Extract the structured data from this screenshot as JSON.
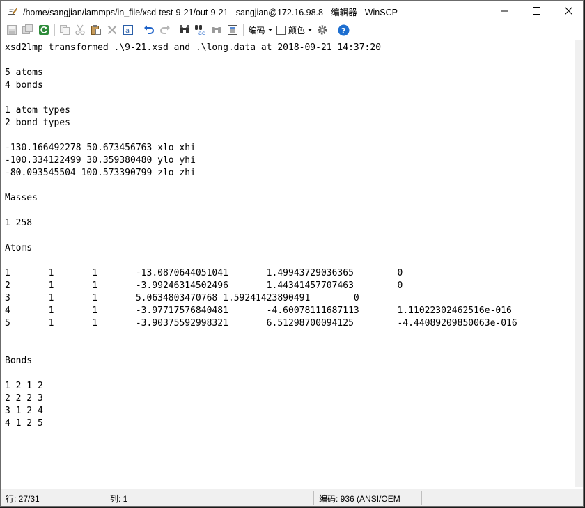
{
  "window": {
    "title": "/home/sangjian/lammps/in_file/xsd-test-9-21/out-9-21 - sangjian@172.16.98.8 - 编辑器 - WinSCP"
  },
  "toolbar": {
    "icons": [
      "save-icon",
      "save-all-icon",
      "reload-icon",
      "copy-icon",
      "cut-icon",
      "paste-icon",
      "delete-icon",
      "select-all-icon",
      "undo-icon",
      "redo-icon",
      "find-icon",
      "replace-icon",
      "find-next-icon",
      "goto-line-icon",
      "settings-icon",
      "help-icon"
    ],
    "encoding_label": "编码",
    "color_label": "颜色",
    "accent": "#1e6fd0"
  },
  "editor": {
    "lines": [
      "xsd2lmp transformed .\\9-21.xsd and .\\long.data at 2018-09-21 14:37:20",
      "",
      "5 atoms",
      "4 bonds",
      "",
      "1 atom types",
      "2 bond types",
      "",
      "-130.166492278 50.673456763 xlo xhi",
      "-100.334122499 30.359380480 ylo yhi",
      "-80.093545504 100.573390799 zlo zhi",
      "",
      "Masses",
      "",
      "1 258",
      "",
      "Atoms",
      "",
      "1       1       1       -13.0870644051041       1.49943729036365        0",
      "2       1       1       -3.99246314502496       1.44341457707463        0",
      "3       1       1       5.0634803470768 1.59241423890491        0",
      "4       1       1       -3.97717576840481       -4.60078111687113       1.11022302462516e-016",
      "5       1       1       -3.90375592998321       6.51298700094125        -4.44089209850063e-016",
      "",
      "",
      "Bonds",
      "",
      "1 2 1 2",
      "2 2 2 3",
      "3 1 2 4",
      "4 1 2 5"
    ]
  },
  "status": {
    "line": "行: 27/31",
    "column": "列: 1",
    "encoding": "编码:  936  (ANSI/OEM"
  }
}
